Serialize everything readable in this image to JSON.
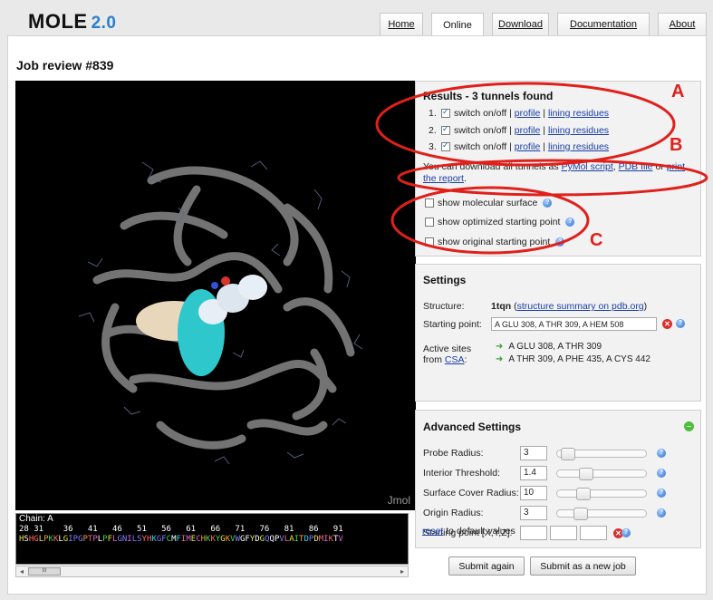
{
  "header": {
    "logo": "MOLE",
    "version": "2.0",
    "tabs": [
      {
        "label": "Home",
        "active": false
      },
      {
        "label": "Online",
        "active": true
      },
      {
        "label": "Download",
        "active": false
      },
      {
        "label": "Documentation",
        "active": false
      },
      {
        "label": "About",
        "active": false
      }
    ]
  },
  "page": {
    "title": "Job review #839"
  },
  "viewer": {
    "watermark": "Jmol",
    "chain_label": "Chain: A",
    "sequence_numbers": "28 31    36   41   46   51   56   61   66   71   76   81   86   91",
    "sequence_residues": "HSHGLPKKLGIPGPTPLPFLGNILSYHKGFCMFIMECHKKYGKVWGFYDGQQPVLAITDPDMIKTV"
  },
  "results": {
    "title": "Results - 3 tunnels found",
    "tunnels": [
      {
        "num": "1.",
        "switch": "switch on/off",
        "sep": "|",
        "profile": "profile",
        "lining": "lining residues",
        "checked": true
      },
      {
        "num": "2.",
        "switch": "switch on/off",
        "sep": "|",
        "profile": "profile",
        "lining": "lining residues",
        "checked": true
      },
      {
        "num": "3.",
        "switch": "switch on/off",
        "sep": "|",
        "profile": "profile",
        "lining": "lining residues",
        "checked": true
      }
    ],
    "download_prefix": "You can download all tunnels as",
    "pymol_link": "PyMol script",
    "comma": ",",
    "pdb_link": "PDB file",
    "or": "or",
    "print_link": "print the report",
    "period": ".",
    "options": [
      {
        "label": "show molecular surface",
        "checked": false
      },
      {
        "label": "show optimized starting point",
        "checked": false
      },
      {
        "label": "show original starting point",
        "checked": false
      }
    ]
  },
  "settings": {
    "title": "Settings",
    "structure_label": "Structure:",
    "structure_id": "1tqn",
    "structure_link": "structure summary on pdb.org",
    "starting_point_label": "Starting point:",
    "starting_point_value": "A GLU 308, A THR 309, A HEM 508",
    "active_sites_label": "Active sites",
    "from_label": "from",
    "csa_link": "CSA",
    "colon": ":",
    "active_sites": [
      "A GLU 308, A THR 309",
      "A THR 309, A PHE 435, A CYS 442"
    ]
  },
  "advanced": {
    "title": "Advanced Settings",
    "params": [
      {
        "label": "Probe Radius:",
        "value": "3",
        "slider": 0.05
      },
      {
        "label": "Interior Threshold:",
        "value": "1.4",
        "slider": 0.28
      },
      {
        "label": "Surface Cover Radius:",
        "value": "10",
        "slider": 0.25
      },
      {
        "label": "Origin Radius:",
        "value": "3",
        "slider": 0.22
      }
    ],
    "xyz_label": "Starting point [X,Y,Z]:",
    "reset_link": "reset",
    "reset_suffix": "to default values"
  },
  "buttons": {
    "submit_again": "Submit again",
    "submit_new": "Submit as a new job"
  },
  "annotations": {
    "a": "A",
    "b": "B",
    "c": "C"
  },
  "colors": {
    "annotation": "#e0201b",
    "link": "#1a3ea8",
    "version": "#2a7fc9"
  }
}
